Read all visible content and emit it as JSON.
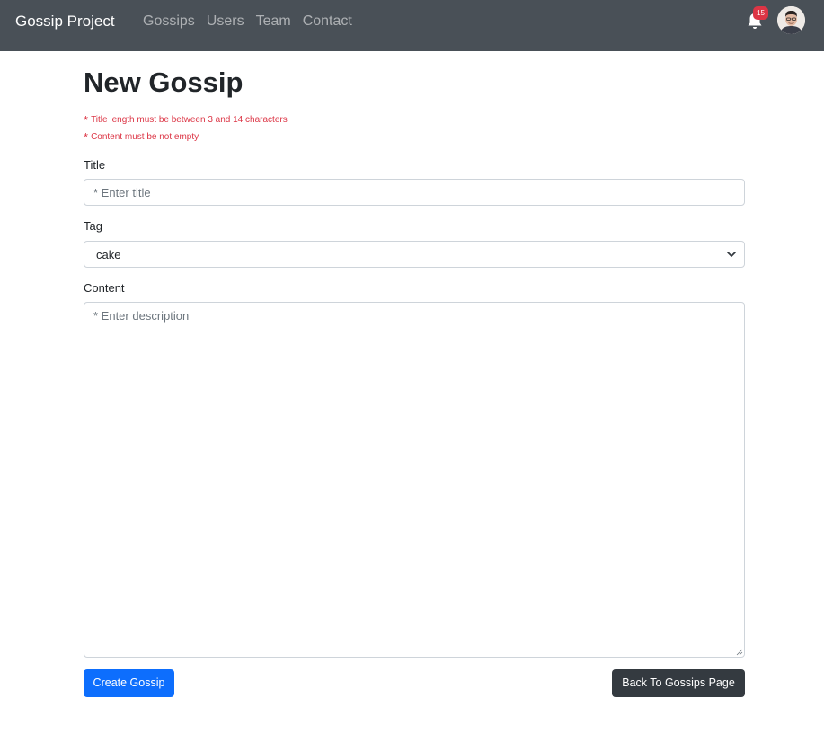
{
  "navbar": {
    "brand": "Gossip Project",
    "links": [
      "Gossips",
      "Users",
      "Team",
      "Contact"
    ],
    "notification_count": "15",
    "icons": {
      "notifications": "bell-icon",
      "user": "avatar"
    }
  },
  "page": {
    "title": "New Gossip",
    "errors": [
      "Title length must be between 3 and 14 characters",
      "Content must be not empty"
    ]
  },
  "form": {
    "title_label": "Title",
    "title_placeholder": "* Enter title",
    "title_value": "",
    "tag_label": "Tag",
    "tag_selected": "cake",
    "content_label": "Content",
    "content_placeholder": "* Enter description",
    "content_value": ""
  },
  "buttons": {
    "create": "Create Gossip",
    "back": "Back To Gossips Page"
  },
  "colors": {
    "navbar_bg": "#495057",
    "error": "#dc3545",
    "primary": "#0d6efd",
    "dark": "#343a40",
    "badge": "#dc3545"
  }
}
